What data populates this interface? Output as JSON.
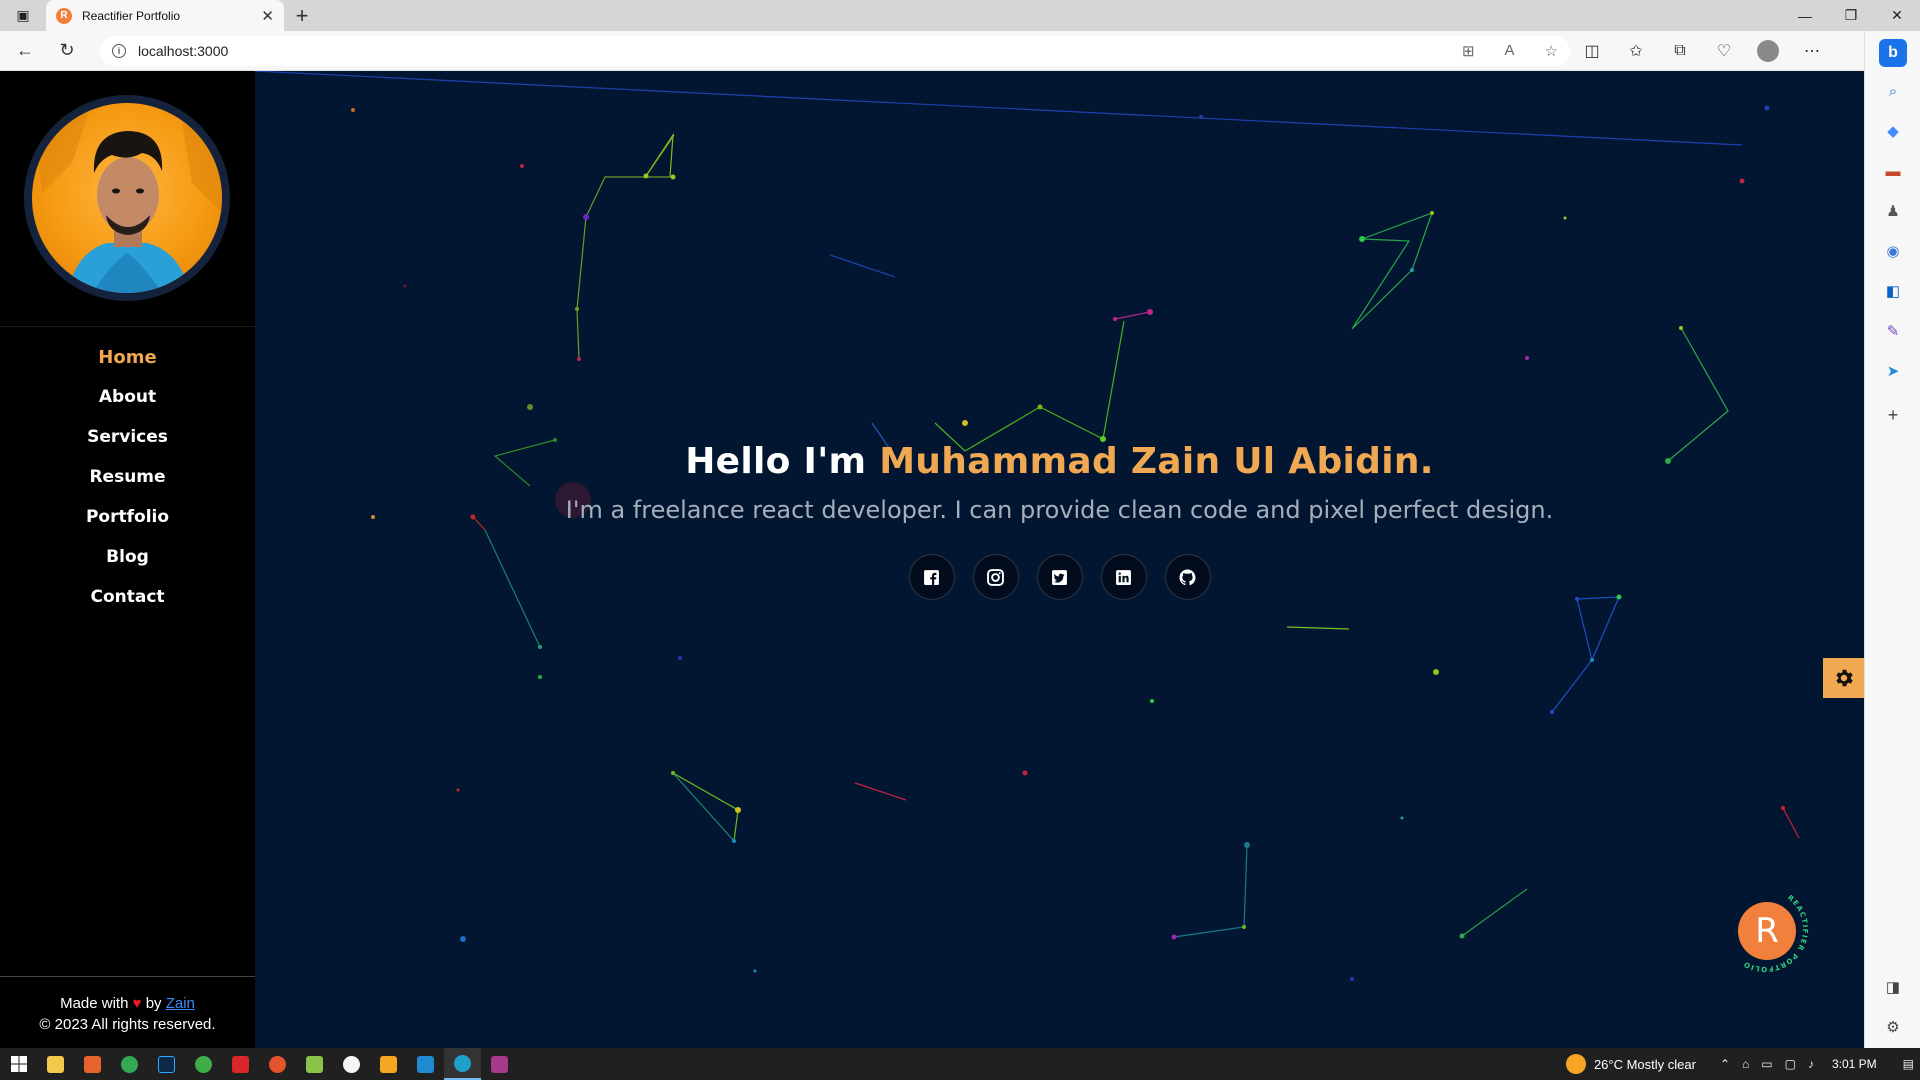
{
  "browser": {
    "tab_title": "Reactifier Portfolio",
    "tab_favicon": "R",
    "url": "localhost:3000"
  },
  "sidebar": {
    "nav": [
      {
        "label": "Home",
        "active": true
      },
      {
        "label": "About",
        "active": false
      },
      {
        "label": "Services",
        "active": false
      },
      {
        "label": "Resume",
        "active": false
      },
      {
        "label": "Portfolio",
        "active": false
      },
      {
        "label": "Blog",
        "active": false
      },
      {
        "label": "Contact",
        "active": false
      }
    ],
    "footer": {
      "made_with": "Made with",
      "by": "by",
      "author": "Zain",
      "copyright": "© 2023 All rights reserved."
    }
  },
  "hero": {
    "greeting": "Hello I'm",
    "name": "Muhammad Zain Ul Abidin.",
    "tagline": "I'm a freelance react developer. I can provide clean code and pixel perfect design.",
    "socials": [
      "facebook-icon",
      "instagram-icon",
      "twitter-icon",
      "linkedin-icon",
      "github-icon"
    ]
  },
  "logo_badge": {
    "letter": "R",
    "ring_text": "REACTIFIER PORTFOLIO"
  },
  "taskbar": {
    "weather": "26°C  Mostly clear",
    "time": "3:01 PM"
  },
  "colors": {
    "accent": "#f1a852",
    "page_bg": "#021631",
    "sidebar_bg": "#000000",
    "logo": "#f0803c"
  }
}
